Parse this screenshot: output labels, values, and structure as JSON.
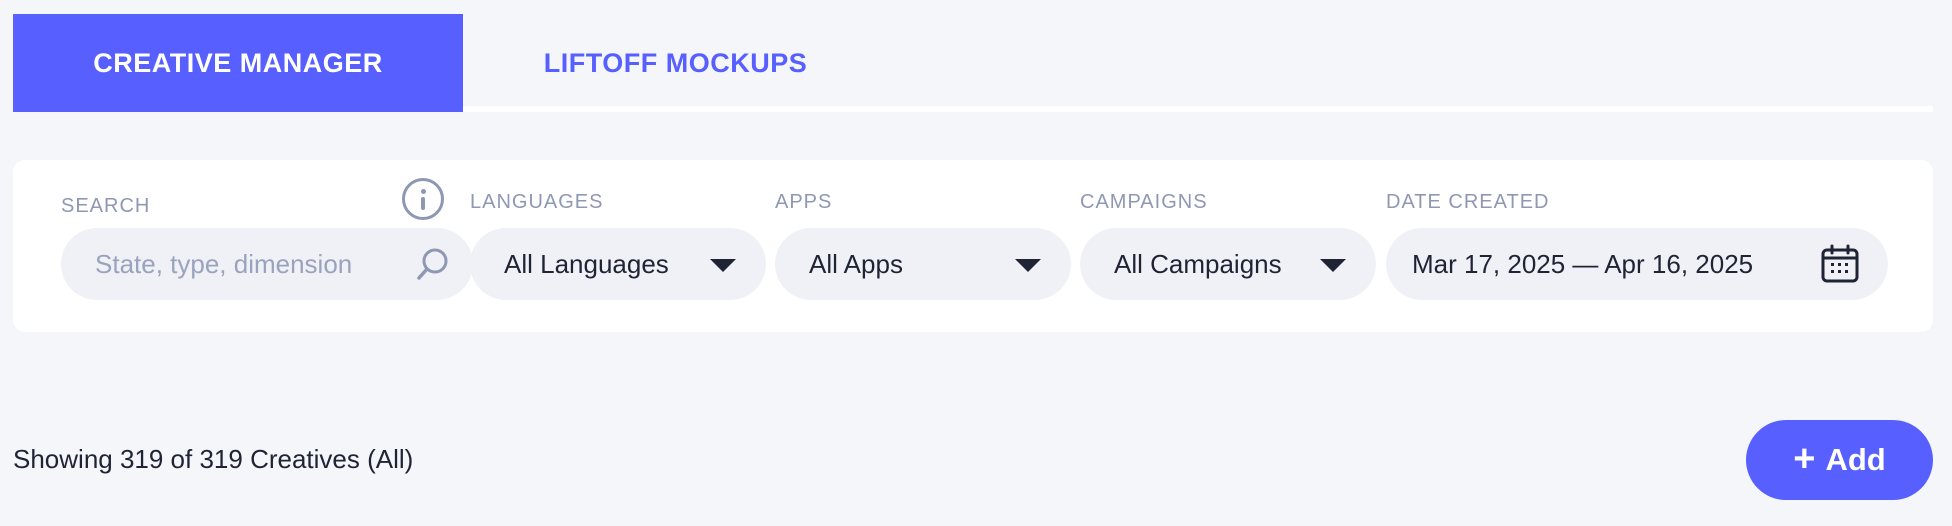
{
  "tabs": [
    {
      "label": "CREATIVE MANAGER",
      "active": true
    },
    {
      "label": "LIFTOFF MOCKUPS",
      "active": false
    }
  ],
  "filters": {
    "search": {
      "label": "SEARCH",
      "placeholder": "State, type, dimension",
      "value": ""
    },
    "languages": {
      "label": "LANGUAGES",
      "value": "All Languages"
    },
    "apps": {
      "label": "APPS",
      "value": "All Apps"
    },
    "campaigns": {
      "label": "CAMPAIGNS",
      "value": "All Campaigns"
    },
    "date_created": {
      "label": "DATE CREATED",
      "value": "Mar 17, 2025 — Apr 16, 2025"
    }
  },
  "summary": {
    "text": "Showing 319 of 319 Creatives (All)"
  },
  "actions": {
    "add_label": "Add"
  },
  "icons": [
    "info-icon",
    "search-icon",
    "caret-down-icon",
    "calendar-icon",
    "plus-icon"
  ],
  "colors": {
    "accent": "#575fff",
    "background": "#f5f6fa",
    "panel": "#ffffff",
    "field": "#eff1f6",
    "label": "#8e98b3"
  }
}
